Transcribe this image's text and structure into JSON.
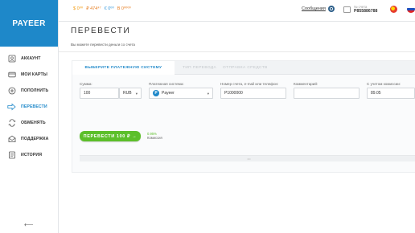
{
  "brand": {
    "logo_text": "PAYEER"
  },
  "balances": {
    "usd": "$ 0⁰⁰",
    "rub": "₽ 474⁴⁷",
    "eur": "€ 0⁰⁰",
    "btc": "B 0⁰⁰⁰⁰"
  },
  "header": {
    "settings_label": "Сообщения",
    "account_label": "№ счета",
    "account_number": "P855886788"
  },
  "sidebar": {
    "items": [
      {
        "label": "АККАУНТ",
        "icon": "account-icon"
      },
      {
        "label": "МОИ КАРТЫ",
        "icon": "cards-icon"
      },
      {
        "label": "ПОПОЛНИТЬ",
        "icon": "plus-circle-icon"
      },
      {
        "label": "ПЕРЕВЕСТИ",
        "icon": "transfer-arrow-icon"
      },
      {
        "label": "ОБМЕНЯТЬ",
        "icon": "exchange-icon"
      },
      {
        "label": "ПОДДЕРЖКА",
        "icon": "support-envelope-icon"
      },
      {
        "label": "ИСТОРИЯ",
        "icon": "history-icon"
      }
    ],
    "active_index": 3,
    "back_glyph": "⟵"
  },
  "page": {
    "title": "ПЕРЕВЕСТИ",
    "subtitle": "Вы можете перевести деньги со счета"
  },
  "tabs": [
    {
      "label": "ВЫБЕРИТЕ ПЛАТЕЖНУЮ СИСТЕМУ"
    },
    {
      "label": "ТИП ПЕРЕВОДА"
    },
    {
      "label": "ОТПРАВКА СРЕДСТВ"
    }
  ],
  "form": {
    "amount": {
      "label": "Сумма:",
      "value": "100",
      "currency": "RUB"
    },
    "payment_system": {
      "label": "Платежная система:",
      "value": "Payeer"
    },
    "recipient": {
      "label": "Номер счета, e-mail или телефон:",
      "value": "P1000000"
    },
    "comment": {
      "label": "Комментарий:",
      "value": ""
    },
    "with_commission": {
      "label": "С учетом комиссии:",
      "value": "89.05"
    },
    "submit_label": "ПЕРЕВЕСТИ 100 ₽ →",
    "commission_pct": "0.95%",
    "commission_label": "Комиссия"
  },
  "history_bar": {
    "text": "•••"
  },
  "colors": {
    "brand": "#1e88c9",
    "accent_green": "#5cbf2a"
  }
}
